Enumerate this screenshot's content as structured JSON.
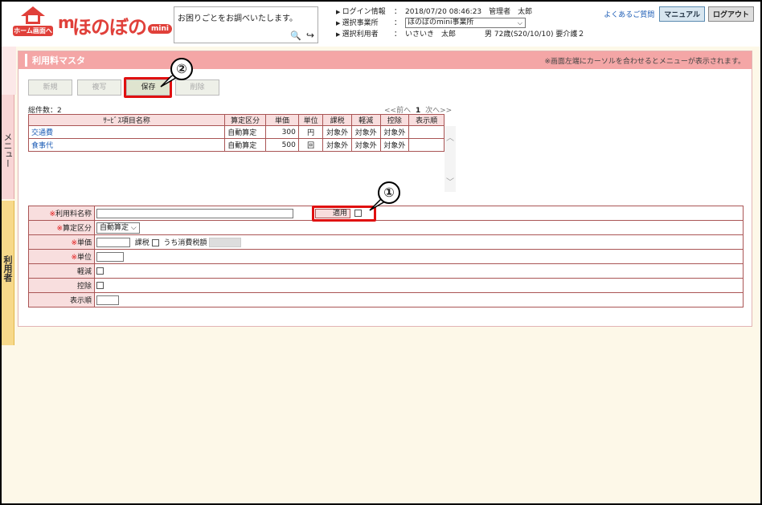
{
  "header": {
    "home_label": "ホーム画面へ",
    "logo_text": "ほのぼの",
    "logo_badge": "mini",
    "search_placeholder": "お困りごとをお調べいたします。",
    "login_label": "ログイン情報",
    "login_value": "2018/07/20 08:46:23　管理者　太郎",
    "office_label": "選択事業所",
    "office_value": "ほのぼのmini事業所",
    "user_label": "選択利用者",
    "user_value": "いさいき　太郎　　　　男 72歳(S20/10/10) 要介護２",
    "faq": "よくあるご質問",
    "manual": "マニュアル",
    "logout": "ログアウト"
  },
  "side": {
    "menu": "メニュー",
    "user": "利用者"
  },
  "panel": {
    "title": "利用料マスタ",
    "hint": "※画面左端にカーソルを合わせるとメニューが表示されます。",
    "toolbar": [
      "新規",
      "複写",
      "保存",
      "削除"
    ],
    "total": "総件数：2",
    "pager_prev": "<<前へ",
    "pager_page": "1",
    "pager_next": "次へ>>"
  },
  "list": {
    "headers": [
      "ｻｰﾋﾞｽ項目名称",
      "算定区分",
      "単価",
      "単位",
      "課税",
      "軽減",
      "控除",
      "表示順"
    ],
    "rows": [
      [
        "交通費",
        "自動算定",
        "300",
        "円",
        "対象外",
        "対象外",
        "対象外",
        ""
      ],
      [
        "食事代",
        "自動算定",
        "500",
        "回",
        "対象外",
        "対象外",
        "対象外",
        ""
      ]
    ]
  },
  "form": {
    "name_label": "利用料名称",
    "apply_label": "適用",
    "calc_label": "算定区分",
    "calc_value": "自動算定",
    "price_label": "単価",
    "tax_label": "課税",
    "incl_tax_label": "うち消費税額",
    "unit_label": "単位",
    "reduce_label": "軽減",
    "deduct_label": "控除",
    "order_label": "表示順",
    "req_mark": "※"
  },
  "callouts": [
    "①",
    "②"
  ],
  "colors": {
    "accent": "#f4a6a6",
    "highlight": "#e01010",
    "link": "#1a5bb5"
  }
}
